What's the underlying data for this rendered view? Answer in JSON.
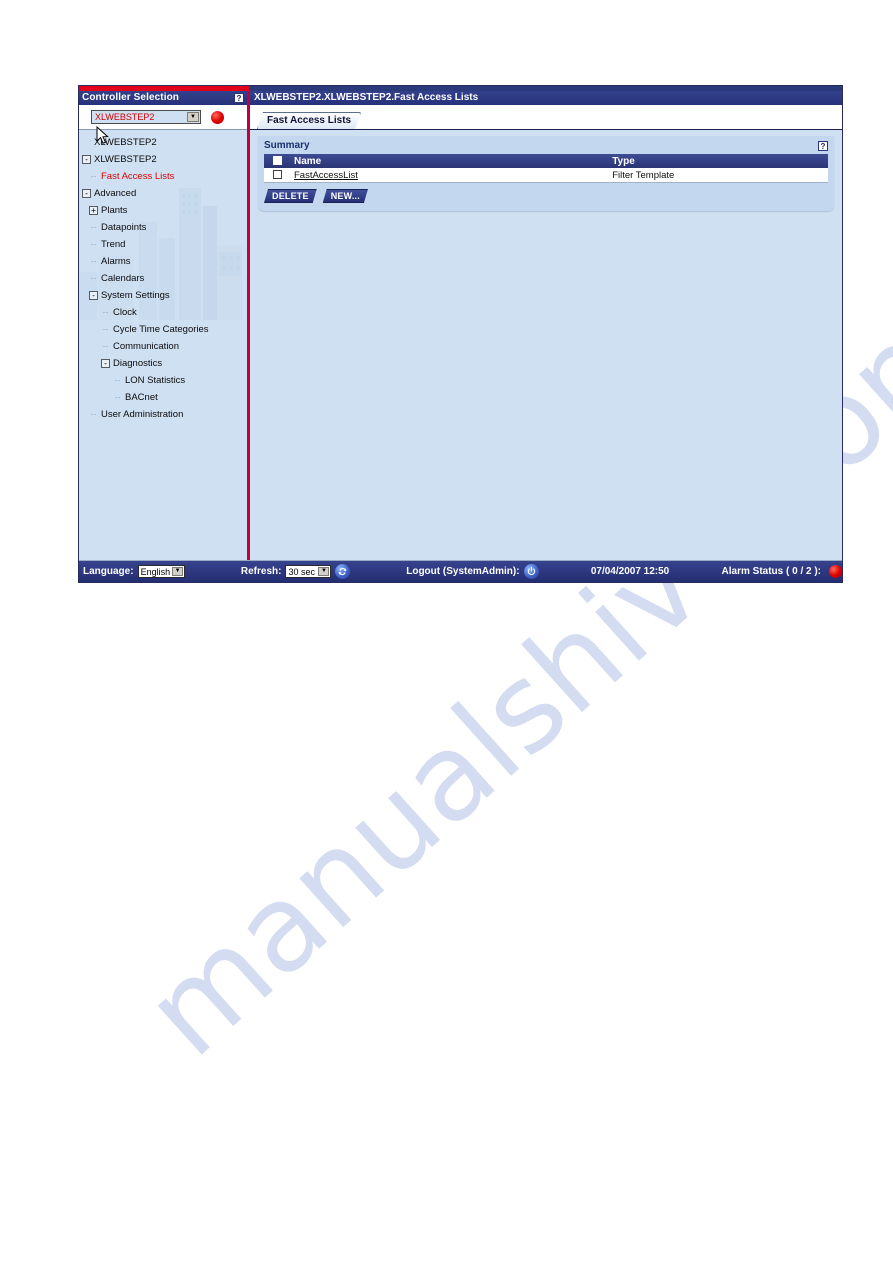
{
  "window": {
    "left_panel_title": "Controller Selection",
    "help_glyph": "?",
    "breadcrumb": "XLWEBSTEP2.XLWEBSTEP2.Fast Access Lists"
  },
  "controller_selector": {
    "value": "XLWEBSTEP2",
    "arrow_glyph": "▼",
    "status_color": "#e00000"
  },
  "tree": {
    "root_label": "XLWEBSTEP2",
    "items": [
      {
        "label": "XLWEBSTEP2",
        "indent": 0,
        "expander": "-",
        "selected": false
      },
      {
        "label": "Fast Access Lists",
        "indent": 1,
        "expander": "",
        "selected": true
      },
      {
        "label": "Advanced",
        "indent": 0,
        "expander": "-",
        "selected": false
      },
      {
        "label": "Plants",
        "indent": 1,
        "expander": "+",
        "selected": false
      },
      {
        "label": "Datapoints",
        "indent": 1,
        "expander": "",
        "selected": false
      },
      {
        "label": "Trend",
        "indent": 1,
        "expander": "",
        "selected": false
      },
      {
        "label": "Alarms",
        "indent": 1,
        "expander": "",
        "selected": false
      },
      {
        "label": "Calendars",
        "indent": 1,
        "expander": "",
        "selected": false
      },
      {
        "label": "System Settings",
        "indent": 1,
        "expander": "-",
        "selected": false
      },
      {
        "label": "Clock",
        "indent": 2,
        "expander": "",
        "selected": false
      },
      {
        "label": "Cycle Time Categories",
        "indent": 2,
        "expander": "",
        "selected": false
      },
      {
        "label": "Communication",
        "indent": 2,
        "expander": "",
        "selected": false
      },
      {
        "label": "Diagnostics",
        "indent": 2,
        "expander": "-",
        "selected": false
      },
      {
        "label": "LON Statistics",
        "indent": 3,
        "expander": "",
        "selected": false
      },
      {
        "label": "BACnet",
        "indent": 3,
        "expander": "",
        "selected": false
      },
      {
        "label": "User Administration",
        "indent": 1,
        "expander": "",
        "selected": false
      }
    ]
  },
  "tabs": [
    {
      "label": "Fast Access Lists",
      "active": true
    }
  ],
  "summary": {
    "title": "Summary",
    "help_glyph": "?",
    "columns": [
      "Name",
      "Type"
    ],
    "rows": [
      {
        "name": "FastAccessList",
        "type": "Filter Template",
        "checked": false
      }
    ],
    "buttons": [
      {
        "label": "DELETE"
      },
      {
        "label": "NEW..."
      }
    ]
  },
  "status_bar": {
    "language_label": "Language:",
    "language_value": "English",
    "refresh_label": "Refresh:",
    "refresh_value": "30 sec",
    "refresh_icon": "refresh-icon",
    "logout_label": "Logout (SystemAdmin):",
    "power_icon": "power-icon",
    "datetime": "07/04/2007 12:50",
    "alarm_label": "Alarm Status (  0  /  2  ):",
    "select_arrow_glyph": "▼"
  },
  "watermark": {
    "text": "manualshive.com"
  }
}
